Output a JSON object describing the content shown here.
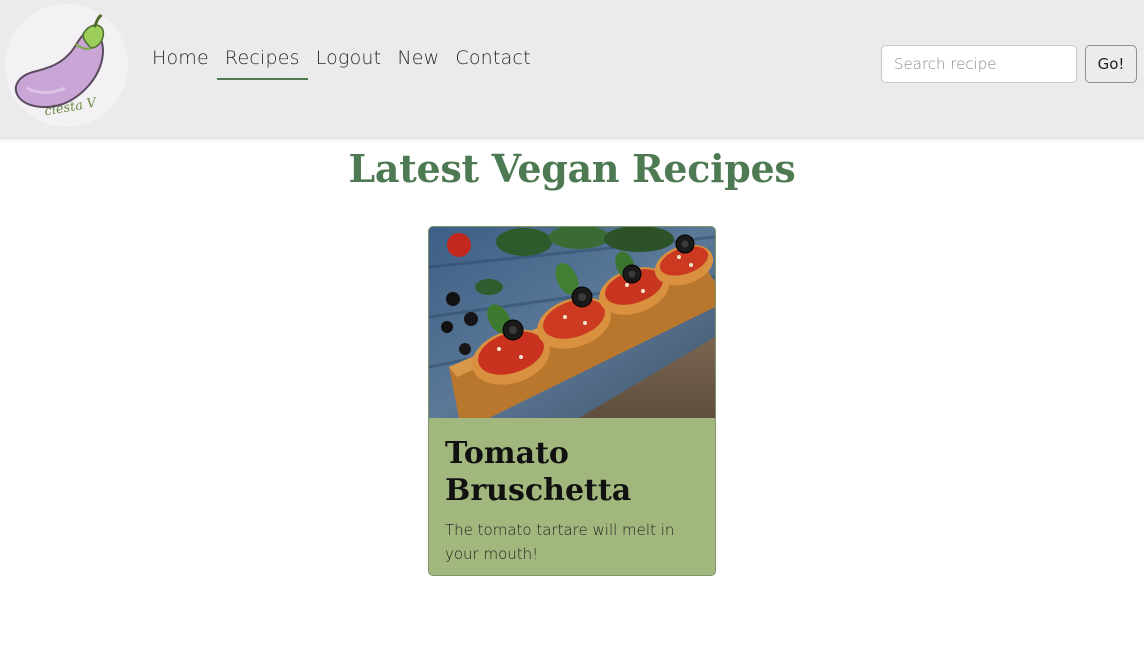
{
  "header": {
    "logo_text": "ciesta V",
    "nav": [
      {
        "label": "Home"
      },
      {
        "label": "Recipes"
      },
      {
        "label": "Logout"
      },
      {
        "label": "New"
      },
      {
        "label": "Contact"
      }
    ],
    "active_nav": "Recipes",
    "search": {
      "placeholder": "Search recipe",
      "value": ""
    },
    "go_label": "Go!"
  },
  "main": {
    "title": "Latest Vegan Recipes",
    "recipes": [
      {
        "title": "Tomato Bruschetta",
        "description": "The tomato tartare will melt in your mouth!"
      }
    ]
  },
  "colors": {
    "accent_green": "#4e7a53",
    "card_background": "#a2b77d",
    "navbar_background": "#ebebeb"
  }
}
